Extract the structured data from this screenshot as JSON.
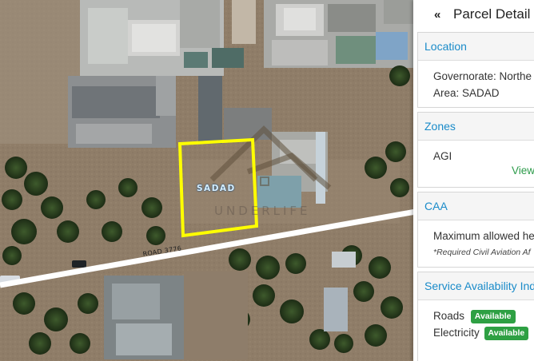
{
  "map": {
    "area_label": "SADAD",
    "road_label": "ROAD 3776",
    "watermark_text": "UNDERLIFE"
  },
  "panel": {
    "title": "Parcel Detail",
    "collapse_icon": "chevron-double-up-icon",
    "location": {
      "heading": "Location",
      "governorate": "Governorate: Northe",
      "area": "Area: SADAD"
    },
    "zones": {
      "heading": "Zones",
      "zone": "AGI",
      "view_link": "View"
    },
    "caa": {
      "heading": "CAA",
      "max_height": "Maximum allowed he",
      "note": "*Required Civil Aviation Af"
    },
    "services": {
      "heading": "Service Availability Ind",
      "roads_label": "Roads",
      "roads_status": "Available",
      "electricity_label": "Electricity",
      "electricity_status": "Available"
    }
  },
  "colors": {
    "parcel_outline": "#ffff00",
    "accent": "#1a8bc9",
    "available": "#2ea043",
    "road": "#ffffff"
  }
}
